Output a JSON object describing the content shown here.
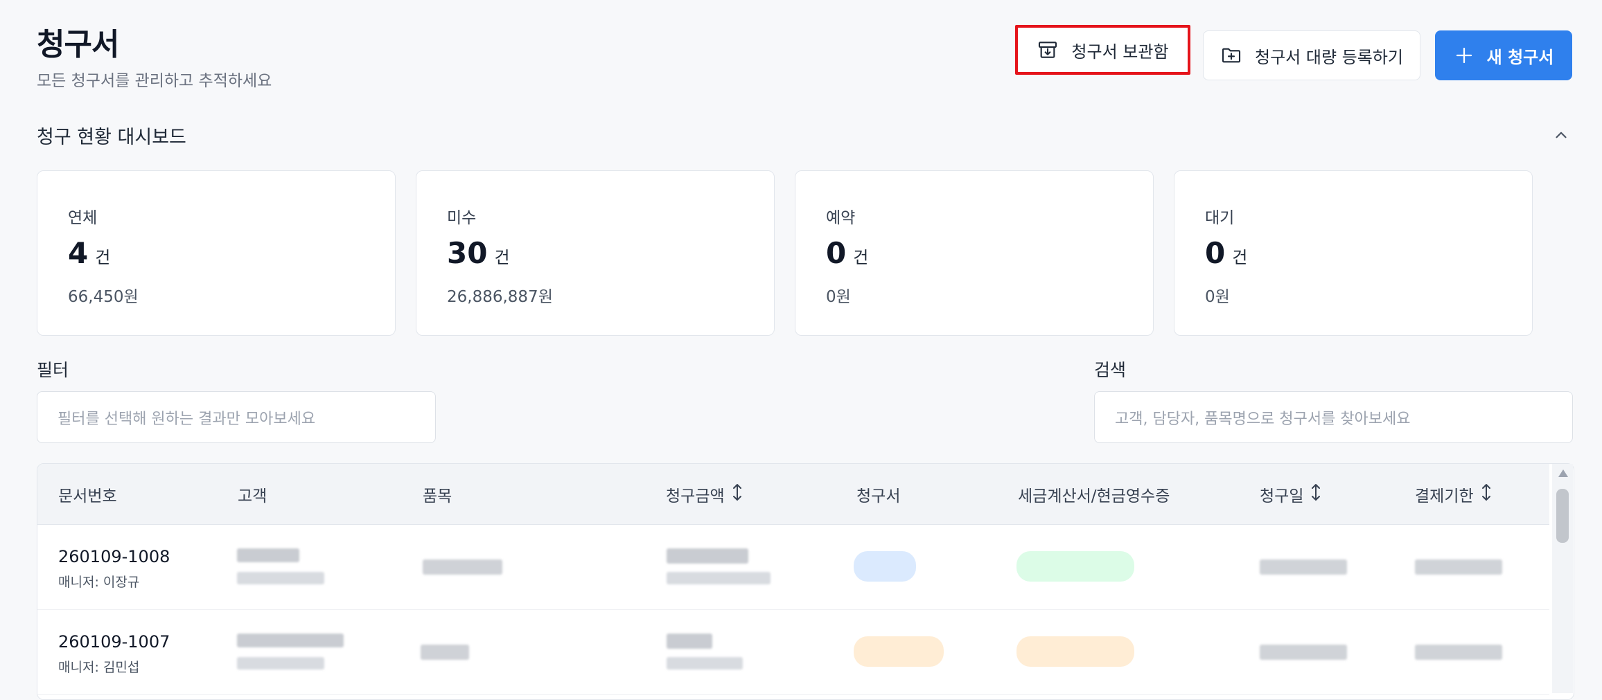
{
  "header": {
    "title": "청구서",
    "subtitle": "모든 청구서를 관리하고 추적하세요",
    "archive_button": "청구서 보관함",
    "bulk_button": "청구서 대량 등록하기",
    "new_button": "새 청구서"
  },
  "dashboard": {
    "title": "청구 현황 대시보드",
    "cards": [
      {
        "label": "연체",
        "count": "4",
        "unit": "건",
        "amount": "66,450원"
      },
      {
        "label": "미수",
        "count": "30",
        "unit": "건",
        "amount": "26,886,887원"
      },
      {
        "label": "예약",
        "count": "0",
        "unit": "건",
        "amount": "0원"
      },
      {
        "label": "대기",
        "count": "0",
        "unit": "건",
        "amount": "0원"
      }
    ]
  },
  "filter": {
    "label": "필터",
    "placeholder": "필터를 선택해 원하는 결과만 모아보세요"
  },
  "search": {
    "label": "검색",
    "placeholder": "고객, 담당자, 품목명으로 청구서를 찾아보세요"
  },
  "table": {
    "columns": [
      "문서번호",
      "고객",
      "품목",
      "청구금액",
      "청구서",
      "세금계산서/현금영수증",
      "청구일",
      "결제기한"
    ],
    "rows": [
      {
        "doc_no": "260109-1008",
        "manager": "매니저: 이장규",
        "invoice_status_color": "#dbeafe",
        "tax_status_color": "#dcfce7"
      },
      {
        "doc_no": "260109-1007",
        "manager": "매니저: 김민섭",
        "invoice_status_color": "#ffedd5",
        "tax_status_color": "#ffedd5"
      }
    ]
  },
  "colors": {
    "accent": "#2f80ed",
    "highlight": "#e5141b"
  }
}
